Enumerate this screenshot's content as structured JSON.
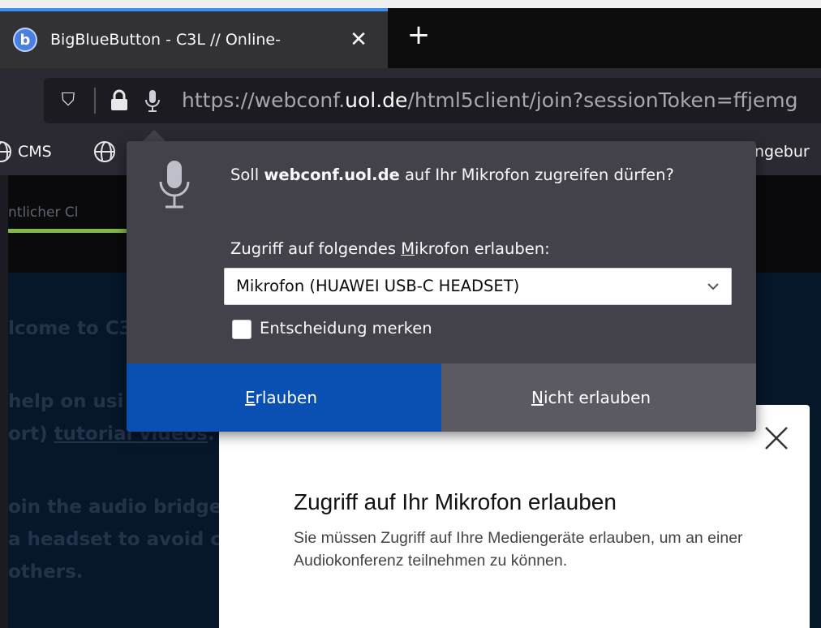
{
  "tab": {
    "title": "BigBlueButton - C3L // Online-",
    "favicon_letter": "b",
    "close_glyph": "✕",
    "new_tab_glyph": "+"
  },
  "urlbar": {
    "shield_glyph": "⛉",
    "url_scheme": "https://",
    "url_sub": "webconf.",
    "url_host": "uol.de",
    "url_path": "/html5client/join?sessionToken=ffjemg",
    "icons": [
      "shield-icon",
      "lock-icon",
      "microphone-icon"
    ]
  },
  "bookmarks": {
    "items": [
      {
        "label": "CMS"
      },
      {
        "label": "ngebur"
      }
    ]
  },
  "page": {
    "upper_text": "ntlicher Cl",
    "chat_lines": [
      {
        "text": "lcome to C3"
      },
      {
        "text": "help on usi"
      },
      {
        "text": "ort) ",
        "link": "tutorial videos",
        "after": "."
      },
      {
        "text": "oin the audio bridge"
      },
      {
        "text": "a headset to avoid c"
      },
      {
        "text": "others."
      }
    ],
    "accent_green": "#82b84a"
  },
  "permission_popup": {
    "question_prefix": "Soll ",
    "question_host": "webconf.uol.de",
    "question_suffix": " auf Ihr Mikrofon zugreifen dürfen?",
    "device_label_before": "Zugriff auf folgendes ",
    "device_label_access_key": "M",
    "device_label_after": "ikrofon erlauben:",
    "selected_device": "Mikrofon (HUAWEI USB-C HEADSET)",
    "remember_label": "Entscheidung merken",
    "remember_checked": false,
    "allow_key": "E",
    "allow_rest": "rlauben",
    "deny_key": "N",
    "deny_rest": "icht erlauben",
    "allow_color": "#0a4fb2",
    "deny_color": "#5b5a63"
  },
  "bbb_modal": {
    "title": "Zugriff auf Ihr Mikrofon erlauben",
    "text": "Sie müssen Zugriff auf Ihre Mediengeräte erlauben, um an einer Audiokonferenz teilnehmen zu können."
  }
}
